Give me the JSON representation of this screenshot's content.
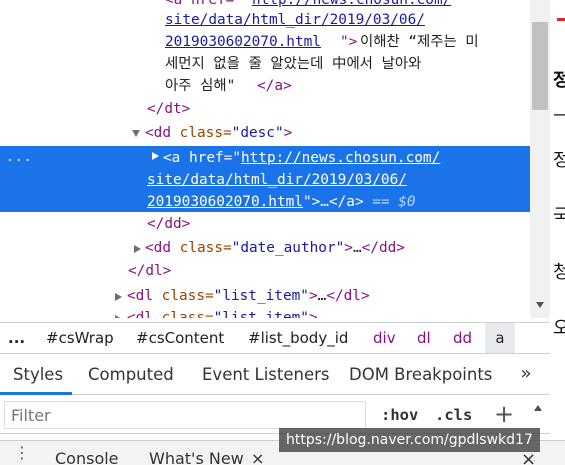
{
  "elements_tree": {
    "line0": {
      "url_part": "http://news.chosun.com/"
    },
    "line1": {
      "url": "site/data/html_dir/2019/03/06/"
    },
    "line2": {
      "url": "2019030602070.html",
      "quote": "\">",
      "text": "이해찬 “제주는 미"
    },
    "line3": {
      "text": "세먼지 없을 줄 알았는데 中에서 날아와"
    },
    "line4": {
      "text": "아주 심해\"",
      "close": "</a>"
    },
    "line5": {
      "close": "</dt>"
    },
    "line6": {
      "tag_open": "<dd",
      "attr": " class=",
      "val": "\"desc\"",
      "tag_end": ">"
    },
    "line7": {
      "dots": "...",
      "tag_open": "<a",
      "attr": " href=",
      "q": "\"",
      "url": "http://news.chosun.com/"
    },
    "line8": {
      "url": "site/data/html_dir/2019/03/06/"
    },
    "line9": {
      "url": "2019030602070.html",
      "q": "\">",
      "ellipsis": "…",
      "close": "</a>",
      "eq": " == $0"
    },
    "line10": {
      "close": "</dd>"
    },
    "line11": {
      "tag_open": "<dd",
      "attr": " class=",
      "val": "\"date_author\"",
      "tag_end": ">",
      "ellipsis": "…",
      "close": "</dd>"
    },
    "line12": {
      "close": "</dl>"
    },
    "line13": {
      "tag_open": "<dl",
      "attr": " class=",
      "val": "\"list_item\"",
      "tag_end": ">",
      "ellipsis": "…",
      "close": "</dl>"
    },
    "line14": {
      "tag_open": "<dl",
      "attr": " class=",
      "val": "\"list_item\"",
      "tag_end": ">"
    }
  },
  "page_edge": {
    "chars": [
      "정",
      "—",
      "정",
      "국",
      "청",
      "오"
    ]
  },
  "breadcrumb": {
    "more": "...",
    "items": [
      "#csWrap",
      "#csContent",
      "#list_body_id",
      "div",
      "dl",
      "dd",
      "a"
    ]
  },
  "tabs": {
    "items": [
      "Styles",
      "Computed",
      "Event Listeners",
      "DOM Breakpoints"
    ],
    "more": "»"
  },
  "filter": {
    "placeholder": "Filter",
    "hov": ":hov",
    "cls": ".cls",
    "add": "+"
  },
  "drawer": {
    "menu": "⋮",
    "tabs": [
      "Console",
      "What's New"
    ],
    "tab_close": "×",
    "close": "×"
  },
  "watermark": {
    "text": "https://blog.naver.com/gpdlswkd17"
  },
  "colors": {
    "selection": "#1a73e8",
    "tag": "#881280",
    "attribute": "#994500",
    "value": "#1a1aa6",
    "edge_bar": "#e5212b"
  }
}
